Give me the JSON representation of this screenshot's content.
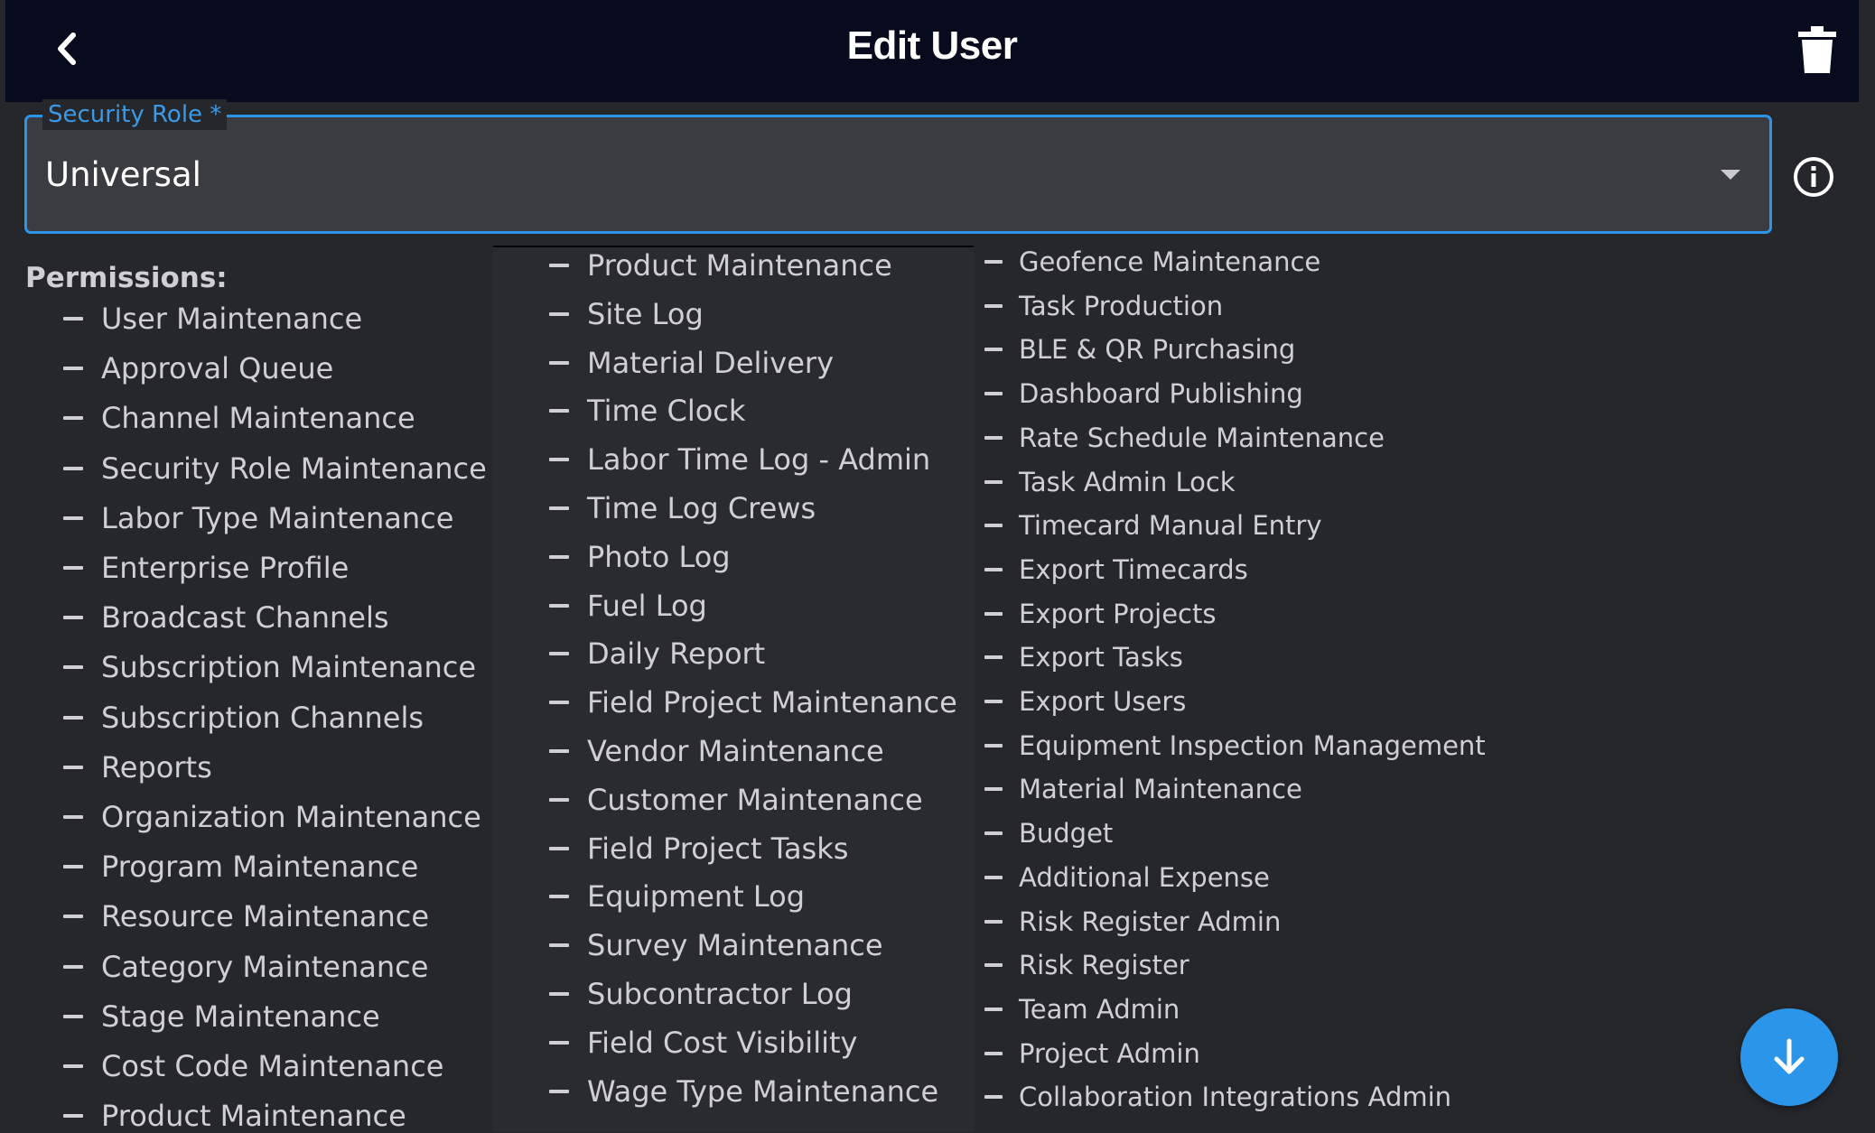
{
  "header": {
    "title": "Edit User"
  },
  "security_role": {
    "label": "Security Role *",
    "value": "Universal"
  },
  "permissions_title": "Permissions:",
  "permissions": {
    "col1": [
      "User Maintenance",
      "Approval Queue",
      "Channel Maintenance",
      "Security Role Maintenance",
      "Labor Type Maintenance",
      "Enterprise Profile",
      "Broadcast Channels",
      "Subscription Maintenance",
      "Subscription Channels",
      "Reports",
      "Organization Maintenance",
      "Program Maintenance",
      "Resource Maintenance",
      "Category Maintenance",
      "Stage Maintenance",
      "Cost Code Maintenance",
      "Product Maintenance"
    ],
    "col2": [
      "Product Maintenance",
      "Site Log",
      "Material Delivery",
      "Time Clock",
      "Labor Time Log - Admin",
      "Time Log Crews",
      "Photo Log",
      "Fuel Log",
      "Daily Report",
      "Field Project Maintenance",
      "Vendor Maintenance",
      "Customer Maintenance",
      "Field Project Tasks",
      "Equipment Log",
      "Survey Maintenance",
      "Subcontractor Log",
      "Field Cost Visibility",
      "Wage Type Maintenance"
    ],
    "col3": [
      "Geofence Maintenance",
      "Task Production",
      "BLE & QR Purchasing",
      "Dashboard Publishing",
      "Rate Schedule Maintenance",
      "Task Admin Lock",
      "Timecard Manual Entry",
      "Export Timecards",
      "Export Projects",
      "Export Tasks",
      "Export Users",
      "Equipment Inspection Management",
      "Material Maintenance",
      "Budget",
      "Additional Expense",
      "Risk Register Admin",
      "Risk Register",
      "Team Admin",
      "Project Admin",
      "Collaboration Integrations Admin"
    ]
  },
  "icons": {
    "back": "chevron-left-icon",
    "delete": "trash-icon",
    "dropdown": "caret-down-icon",
    "info": "info-icon",
    "fab": "arrow-down-icon"
  },
  "colors": {
    "header_bg": "#070b1d",
    "page_bg": "#26272b",
    "accent": "#2c95e8"
  }
}
